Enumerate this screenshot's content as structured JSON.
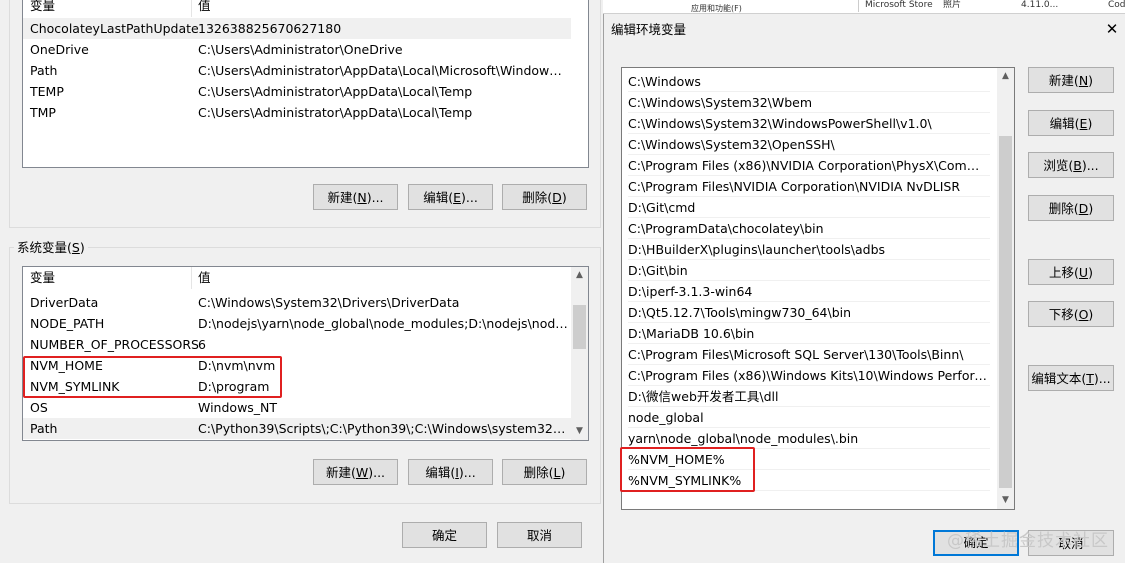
{
  "user_vars": {
    "header": {
      "name": "变量",
      "value": "值"
    },
    "rows": [
      {
        "name": "ChocolateyLastPathUpdate",
        "value": "132638825670627180"
      },
      {
        "name": "OneDrive",
        "value": "C:\\Users\\Administrator\\OneDrive"
      },
      {
        "name": "Path",
        "value": "C:\\Users\\Administrator\\AppData\\Local\\Microsoft\\WindowsA..."
      },
      {
        "name": "TEMP",
        "value": "C:\\Users\\Administrator\\AppData\\Local\\Temp"
      },
      {
        "name": "TMP",
        "value": "C:\\Users\\Administrator\\AppData\\Local\\Temp"
      }
    ],
    "buttons": {
      "new": {
        "text": "新建(",
        "key": "N",
        "tail": ")..."
      },
      "edit": {
        "text": "编辑(",
        "key": "E",
        "tail": ")..."
      },
      "delete": {
        "text": "删除(",
        "key": "D",
        "tail": ")"
      }
    }
  },
  "system_vars": {
    "group_title": {
      "text": "系统变量(",
      "key": "S",
      "tail": ")"
    },
    "header": {
      "name": "变量",
      "value": "值"
    },
    "rows": [
      {
        "name": "DriverData",
        "value": "C:\\Windows\\System32\\Drivers\\DriverData"
      },
      {
        "name": "NODE_PATH",
        "value": "D:\\nodejs\\yarn\\node_global\\node_modules;D:\\nodejs\\node_..."
      },
      {
        "name": "NUMBER_OF_PROCESSORS",
        "value": "6"
      },
      {
        "name": "NVM_HOME",
        "value": "D:\\nvm\\nvm"
      },
      {
        "name": "NVM_SYMLINK",
        "value": "D:\\program"
      },
      {
        "name": "OS",
        "value": "Windows_NT"
      },
      {
        "name": "Path",
        "value": "C:\\Python39\\Scripts\\;C:\\Python39\\;C:\\Windows\\system32;C:\\W..."
      }
    ],
    "buttons": {
      "new": {
        "text": "新建(",
        "key": "W",
        "tail": ")..."
      },
      "edit": {
        "text": "编辑(",
        "key": "I",
        "tail": ")..."
      },
      "delete": {
        "text": "删除(",
        "key": "L",
        "tail": ")"
      }
    }
  },
  "left_footer": {
    "ok": "确定",
    "cancel": "取消"
  },
  "background_strip": {
    "col1": "应用和功能(F)",
    "col2": "Microsoft Store",
    "col3": "照片",
    "col4": "4.11.0...",
    "col5": "Code"
  },
  "edit_dialog": {
    "title": "编辑环境变量",
    "close_glyph": "✕",
    "paths": [
      "C:\\Windows",
      "C:\\Windows\\System32\\Wbem",
      "C:\\Windows\\System32\\WindowsPowerShell\\v1.0\\",
      "C:\\Windows\\System32\\OpenSSH\\",
      "C:\\Program Files (x86)\\NVIDIA Corporation\\PhysX\\Common",
      "C:\\Program Files\\NVIDIA Corporation\\NVIDIA NvDLISR",
      "D:\\Git\\cmd",
      "C:\\ProgramData\\chocolatey\\bin",
      "D:\\HBuilderX\\plugins\\launcher\\tools\\adbs",
      "D:\\Git\\bin",
      "D:\\iperf-3.1.3-win64",
      "D:\\Qt5.12.7\\Tools\\mingw730_64\\bin",
      "D:\\MariaDB 10.6\\bin",
      "C:\\Program Files\\Microsoft SQL Server\\130\\Tools\\Binn\\",
      "C:\\Program Files (x86)\\Windows Kits\\10\\Windows Performan...",
      "D:\\微信web开发者工具\\dll",
      "node_global",
      "yarn\\node_global\\node_modules\\.bin",
      "%NVM_HOME%",
      "%NVM_SYMLINK%"
    ],
    "buttons": {
      "new": {
        "text": "新建(",
        "key": "N",
        "tail": ")"
      },
      "edit": {
        "text": "编辑(",
        "key": "E",
        "tail": ")"
      },
      "browse": {
        "text": "浏览(",
        "key": "B",
        "tail": ")..."
      },
      "delete": {
        "text": "删除(",
        "key": "D",
        "tail": ")"
      },
      "move_up": {
        "text": "上移(",
        "key": "U",
        "tail": ")"
      },
      "move_down": {
        "text": "下移(",
        "key": "O",
        "tail": ")"
      },
      "edit_text": {
        "text": "编辑文本(",
        "key": "T",
        "tail": ")..."
      }
    },
    "ok": "确定",
    "cancel": "取消"
  },
  "watermark": "@稀土掘金技术社区",
  "colors": {
    "highlight_box": "#e02020",
    "default_button_border": "#0078d7"
  }
}
